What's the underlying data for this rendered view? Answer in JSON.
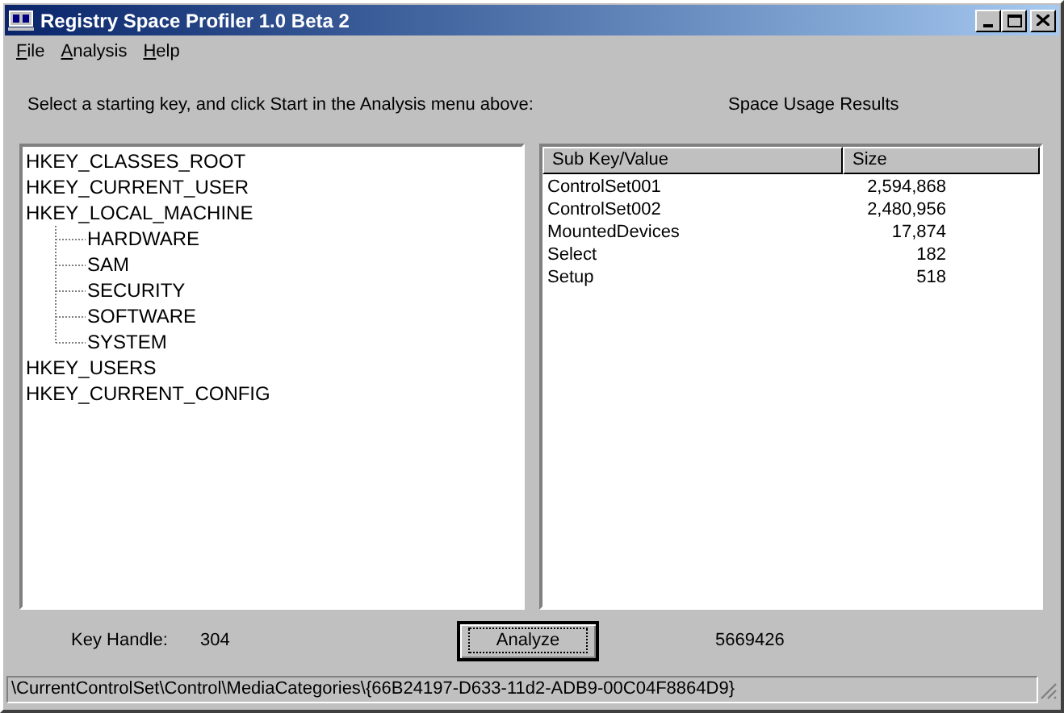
{
  "window": {
    "title": "Registry Space Profiler 1.0 Beta 2"
  },
  "menu": [
    "File",
    "Analysis",
    "Help"
  ],
  "instruction": "Select a starting key, and click Start in the Analysis menu above:",
  "results_heading": "Space Usage Results",
  "tree": [
    {
      "label": "HKEY_CLASSES_ROOT"
    },
    {
      "label": "HKEY_CURRENT_USER"
    },
    {
      "label": "HKEY_LOCAL_MACHINE",
      "children": [
        {
          "label": "HARDWARE"
        },
        {
          "label": "SAM"
        },
        {
          "label": "SECURITY"
        },
        {
          "label": "SOFTWARE"
        },
        {
          "label": "SYSTEM"
        }
      ]
    },
    {
      "label": "HKEY_USERS"
    },
    {
      "label": "HKEY_CURRENT_CONFIG"
    }
  ],
  "table": {
    "columns": [
      "Sub Key/Value",
      "Size"
    ],
    "rows": [
      [
        "ControlSet001",
        "2,594,868"
      ],
      [
        "ControlSet002",
        "2,480,956"
      ],
      [
        "MountedDevices",
        "17,874"
      ],
      [
        "Select",
        "182"
      ],
      [
        "Setup",
        "518"
      ]
    ]
  },
  "key_handle": {
    "label": "Key Handle:",
    "value": "304"
  },
  "analyze_button": "Analyze",
  "total": "5669426",
  "status_bar": "\\CurrentControlSet\\Control\\MediaCategories\\{66B24197-D633-11d2-ADB9-00C04F8864D9}"
}
